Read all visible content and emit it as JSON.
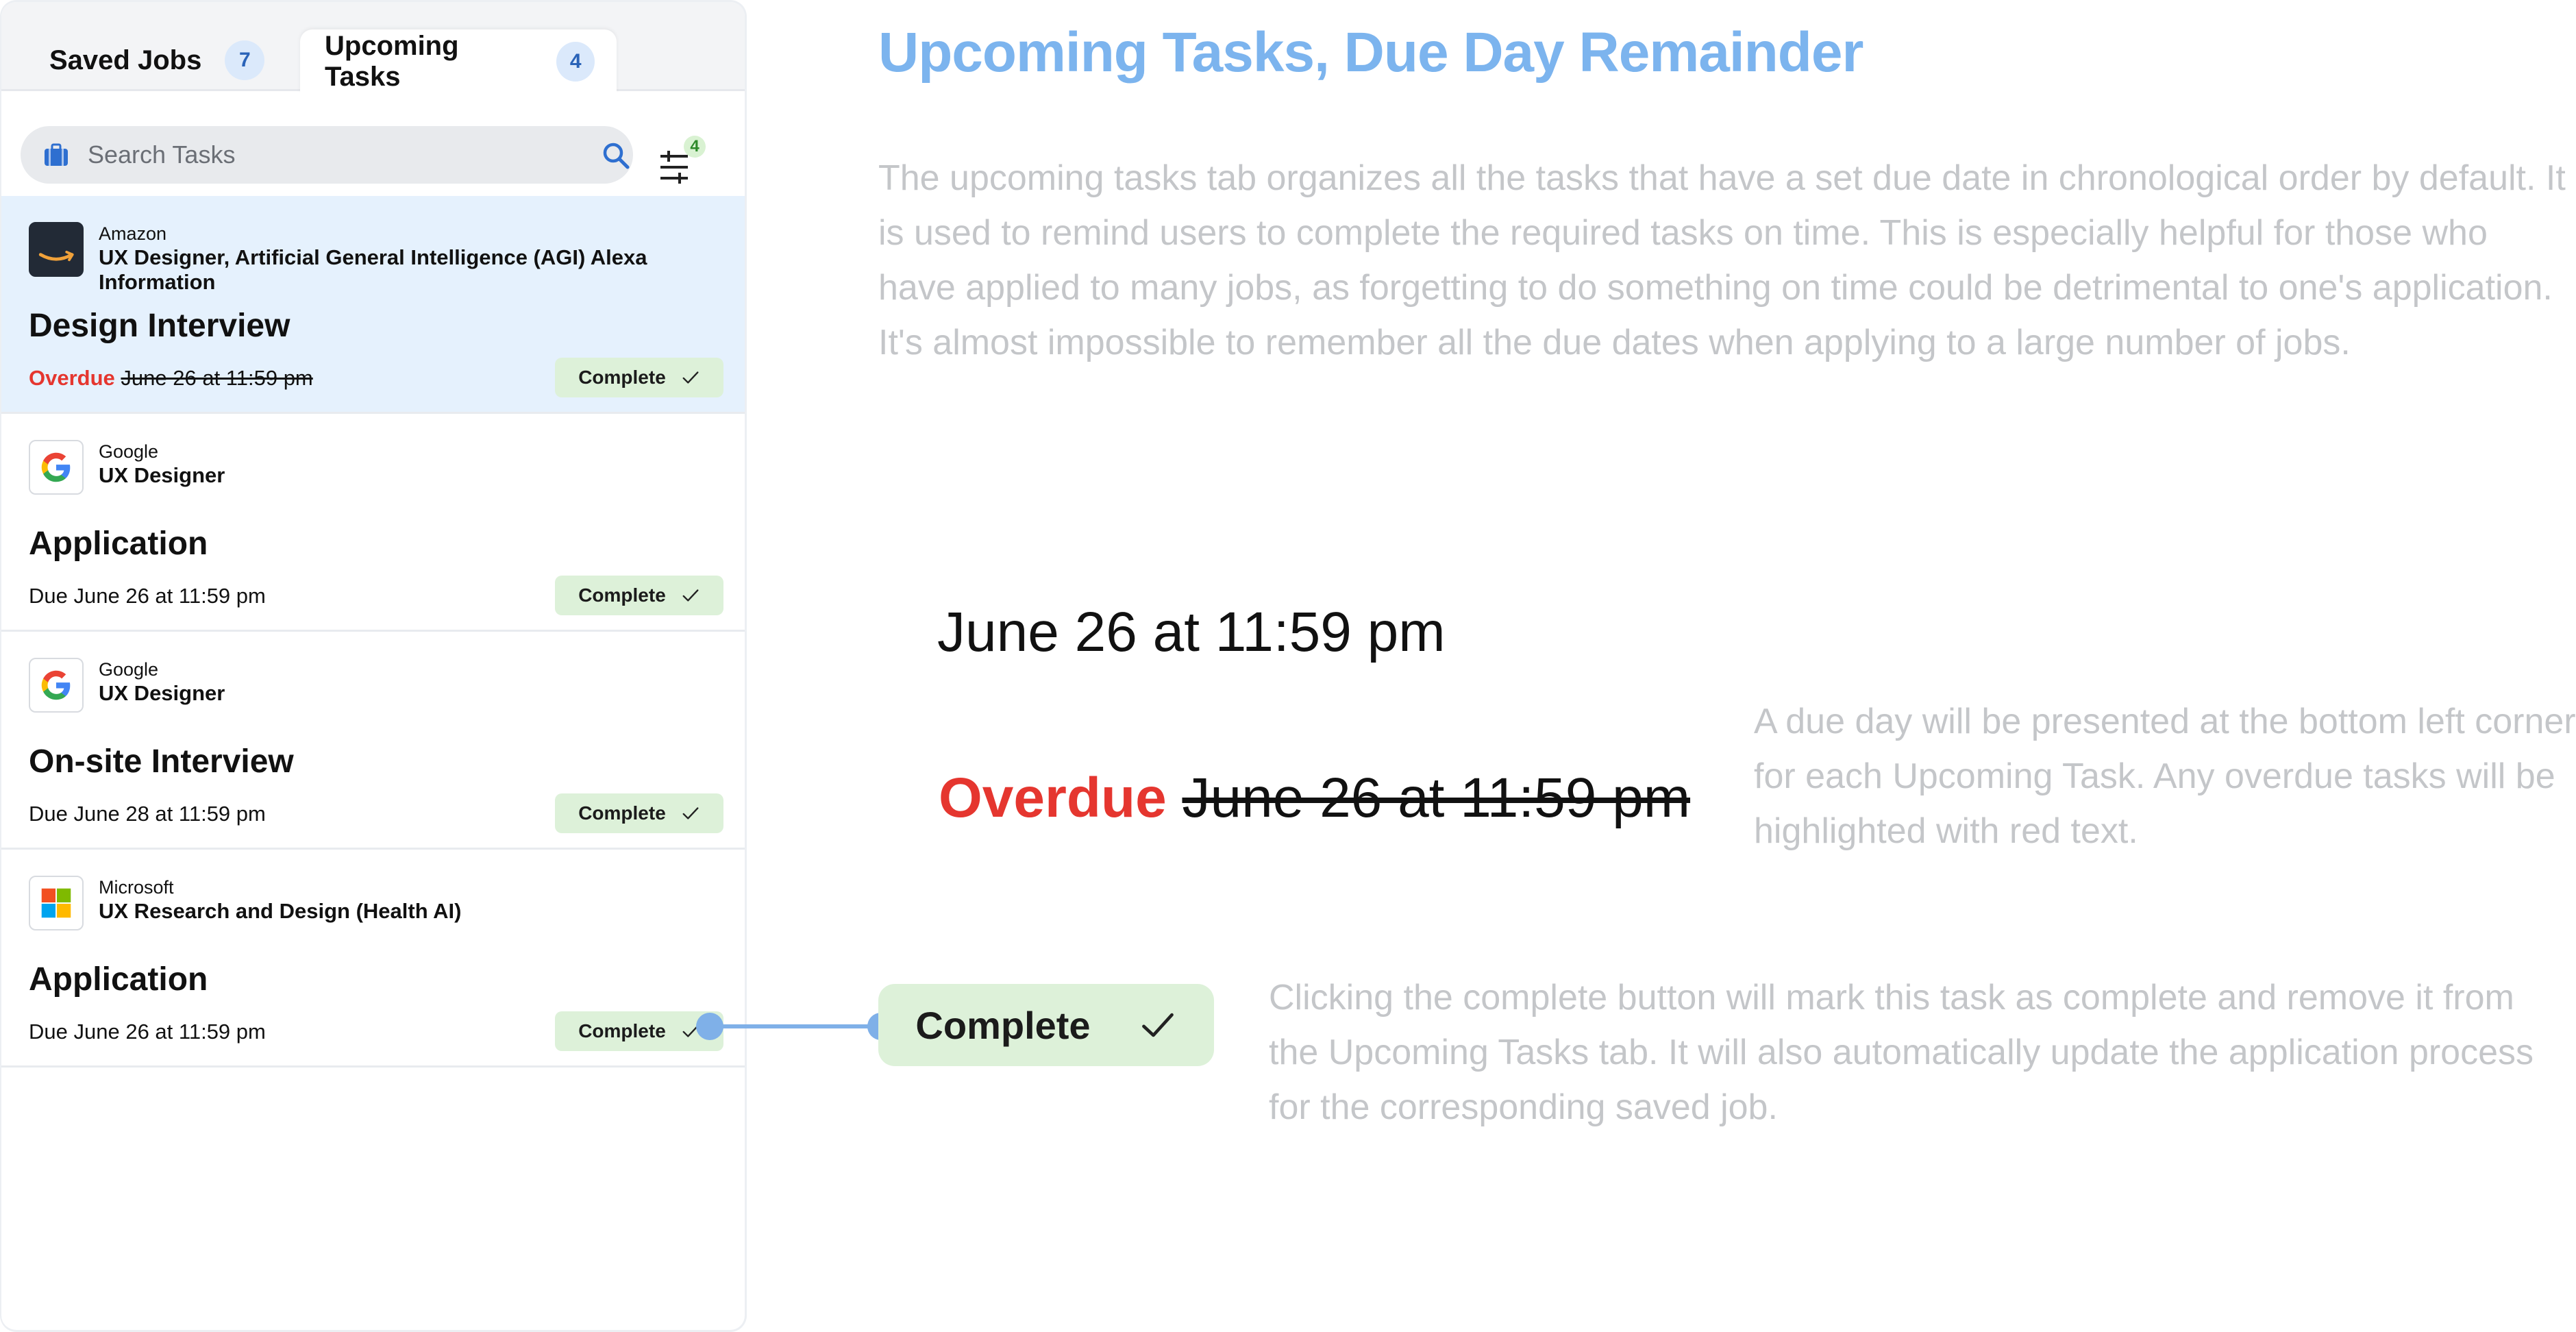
{
  "tabs": [
    {
      "label": "Saved Jobs",
      "count": "7"
    },
    {
      "label": "Upcoming Tasks",
      "count": "4"
    }
  ],
  "search": {
    "placeholder": "Search Tasks"
  },
  "filter": {
    "count": "4"
  },
  "tasks": [
    {
      "company": "Amazon",
      "role": "UX Designer, Artificial General Intelligence (AGI) Alexa Information",
      "task": "Design Interview",
      "status": "Overdue",
      "due_prefix": "",
      "due_date": "June 26 at 11:59 pm",
      "action": "Complete"
    },
    {
      "company": "Google",
      "role": "UX Designer",
      "task": "Application",
      "status": "",
      "due_prefix": "Due",
      "due_date": "June 26 at 11:59 pm",
      "action": "Complete"
    },
    {
      "company": "Google",
      "role": "UX Designer",
      "task": "On-site Interview",
      "status": "",
      "due_prefix": "Due",
      "due_date": "June 28 at 11:59 pm",
      "action": "Complete"
    },
    {
      "company": "Microsoft",
      "role": "UX Research and Design (Health AI)",
      "task": "Application",
      "status": "",
      "due_prefix": "Due",
      "due_date": "June 26 at 11:59 pm",
      "action": "Complete"
    }
  ],
  "annotation": {
    "title": "Upcoming Tasks, Due Day Remainder",
    "intro": "The upcoming tasks tab organizes all the tasks that have a set due date in chronological order by default. It is used to remind users to complete the required tasks on time. This is especially helpful for those who have applied to many jobs, as forgetting to do something on time could be detrimental to one's application. It's almost impossible to remember all the due dates when applying to a large number of jobs.",
    "example_date": "June 26 at 11:59 pm",
    "example_overdue_label": "Overdue",
    "example_overdue_date": "June 26 at 11:59 pm",
    "due_note": "A due day will be presented at the bottom left corner for each Upcoming Task. Any overdue tasks will be highlighted with red text.",
    "complete_label": "Complete",
    "complete_note": "Clicking the complete button will mark this task as complete and remove it from the Upcoming Tasks tab. It will also automatically update the application process for the corresponding saved job."
  },
  "colors": {
    "accent_blue": "#7cb4ee",
    "overdue_red": "#e5362f",
    "complete_green": "#ddf1d9",
    "active_card": "#e5f1fd"
  }
}
